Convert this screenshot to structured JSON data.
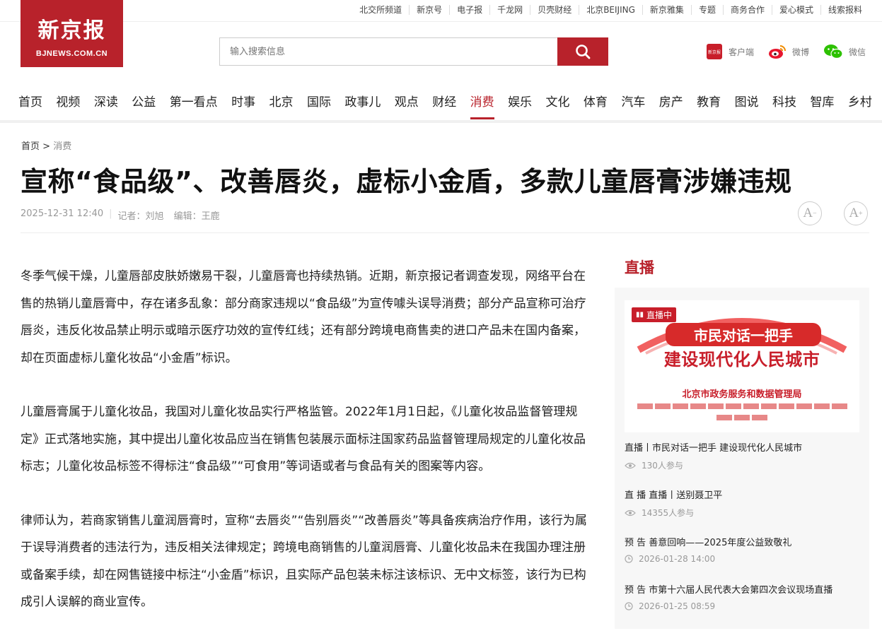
{
  "top_links": [
    "北交所频道",
    "新京号",
    "电子报",
    "千龙网",
    "贝壳财经",
    "北京BEIJING",
    "新京雅集",
    "专题",
    "商务合作",
    "爱心模式",
    "线索报料"
  ],
  "logo": {
    "cn": "新京报",
    "en": "BJNEWS.COM.CN"
  },
  "search": {
    "placeholder": "输入搜索信息"
  },
  "share": {
    "client": "客户端",
    "weibo": "微博",
    "wechat": "微信",
    "client_badge": "新京报"
  },
  "nav": [
    "首页",
    "视频",
    "深读",
    "公益",
    "第一看点",
    "时事",
    "北京",
    "国际",
    "政事儿",
    "观点",
    "财经",
    "消费",
    "娱乐",
    "文化",
    "体育",
    "汽车",
    "房产",
    "教育",
    "图说",
    "科技",
    "智库",
    "乡村"
  ],
  "nav_active": "消费",
  "breadcrumb": {
    "home": "首页",
    "sep": ">",
    "current": "消费"
  },
  "article": {
    "title": "宣称“食品级”、改善唇炎，虚标小金盾，多款儿童唇膏涉嫌违规",
    "date": "2025-12-31 12:40",
    "reporter": "记者：刘旭",
    "editor": "编辑：王鹿",
    "paragraphs": [
      "冬季气候干燥，儿童唇部皮肤娇嫩易干裂，儿童唇膏也持续热销。近期，新京报记者调查发现，网络平台在售的热销儿童唇膏中，存在诸多乱象：部分商家违规以“食品级”为宣传噱头误导消费；部分产品宣称可治疗唇炎，违反化妆品禁止明示或暗示医疗功效的宣传红线；还有部分跨境电商售卖的进口产品未在国内备案，却在页面虚标儿童化妆品“小金盾”标识。",
      "儿童唇膏属于儿童化妆品，我国对儿童化妆品实行严格监管。2022年1月1日起，《儿童化妆品监督管理规定》正式落地实施，其中提出儿童化妆品应当在销售包装展示面标注国家药品监督管理局规定的儿童化妆品标志；儿童化妆品标签不得标注“食品级”“可食用”等词语或者与食品有关的图案等内容。",
      "律师认为，若商家销售儿童润唇膏时，宣称“去唇炎”“告别唇炎”“改善唇炎”等具备疾病治疗作用，该行为属于误导消费者的违法行为，违反相关法律规定；跨境电商销售的儿童润唇膏、儿童化妆品未在我国办理注册或备案手续，却在网售链接中标注“小金盾”标识，且实际产品包装未标注该标识、无中文标签，该行为已构成引人误解的商业宣传。"
    ]
  },
  "font_buttons": {
    "decrease": "A",
    "increase": "A"
  },
  "sidebar": {
    "title": "直播",
    "banner": {
      "badge": "直播中",
      "line1": "市民对话一把手",
      "line2": "建设现代化人民城市",
      "line3": "北京市政务服务和数据管理局"
    },
    "items": [
      {
        "title": "直播丨市民对话一把手 建设现代化人民城市",
        "sub": "130人参与",
        "icon": "eye-icon"
      },
      {
        "title": "直 播 直播丨送别聂卫平",
        "sub": "14355人参与",
        "icon": "eye-icon"
      },
      {
        "title": "预 告 善意回响——2025年度公益致敬礼",
        "sub": "2026-01-28 14:00",
        "icon": "clock-icon"
      },
      {
        "title": "预 告 市第十六届人民代表大会第四次会议现场直播",
        "sub": "2026-01-25 08:59",
        "icon": "clock-icon"
      }
    ]
  },
  "colors": {
    "brand": "#b8222b",
    "muted": "#999999"
  }
}
